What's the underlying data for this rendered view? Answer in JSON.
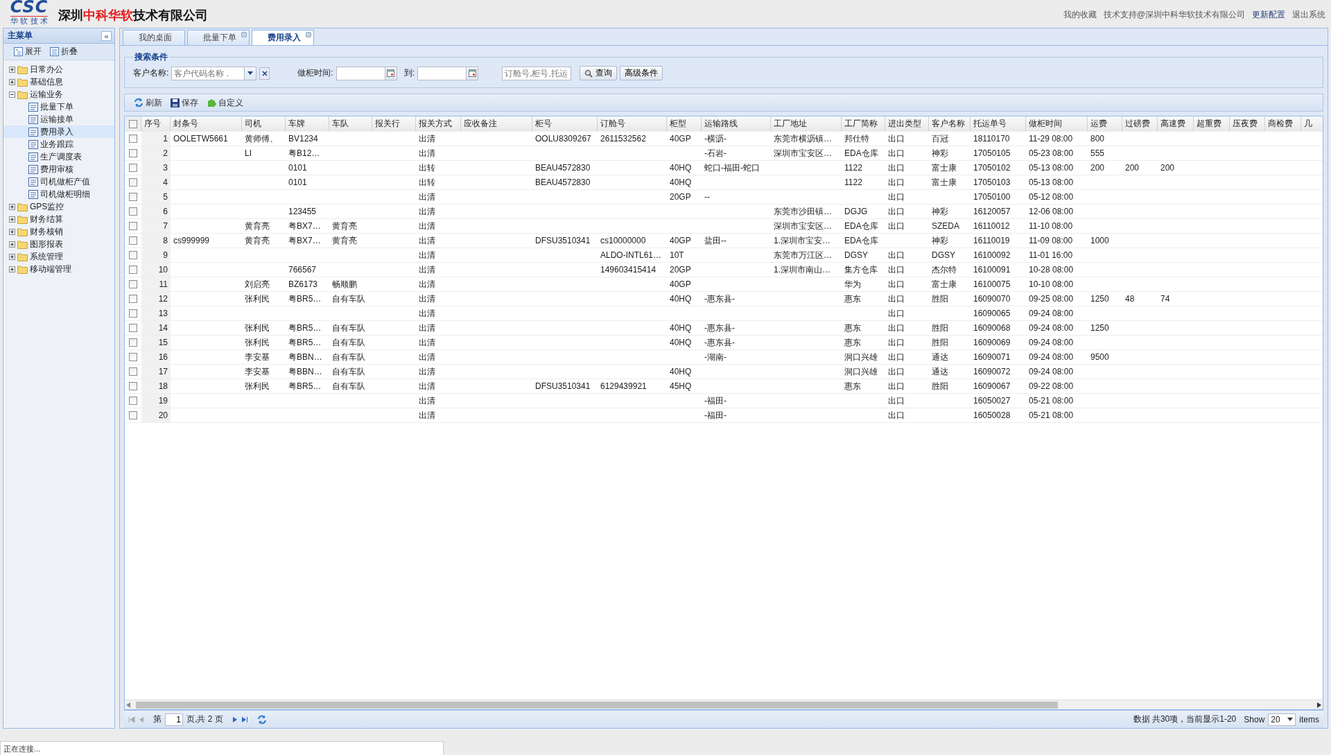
{
  "header": {
    "logo": {
      "mark": "CSC",
      "tagline": "华 软 技 术"
    },
    "company": "深圳**中科华软**技术有限公司",
    "links": [
      {
        "label": "我的收藏",
        "kind": "plain"
      },
      {
        "label": "技术支持@深圳中科华软技术有限公司",
        "kind": "plain"
      },
      {
        "label": "更新配置",
        "kind": "accent"
      },
      {
        "label": "退出系统",
        "kind": "plain"
      }
    ]
  },
  "sidebar": {
    "title": "主菜单",
    "collapse": "«",
    "actions": [
      {
        "label": "展开",
        "kind": "expand"
      },
      {
        "label": "折叠",
        "kind": "collapse"
      }
    ],
    "items": [
      {
        "label": "日常办公",
        "expanded": false,
        "selected": false
      },
      {
        "label": "基础信息",
        "expanded": false,
        "selected": false
      },
      {
        "label": "运输业务",
        "expanded": true,
        "selected": false,
        "children": [
          {
            "label": "批量下单",
            "selected": false
          },
          {
            "label": "运输接单",
            "selected": false
          },
          {
            "label": "费用录入",
            "selected": true
          },
          {
            "label": "业务跟踪",
            "selected": false
          },
          {
            "label": "生产调度表",
            "selected": false
          },
          {
            "label": "费用审核",
            "selected": false
          },
          {
            "label": "司机做柜产值",
            "selected": false
          },
          {
            "label": "司机做柜明细",
            "selected": false
          }
        ]
      },
      {
        "label": "GPS监控",
        "expanded": false,
        "selected": false
      },
      {
        "label": "财务结算",
        "expanded": false,
        "selected": false
      },
      {
        "label": "财务核销",
        "expanded": false,
        "selected": false
      },
      {
        "label": "图形报表",
        "expanded": false,
        "selected": false
      },
      {
        "label": "系统管理",
        "expanded": false,
        "selected": false
      },
      {
        "label": "移动端管理",
        "expanded": false,
        "selected": false
      }
    ]
  },
  "tabs": [
    {
      "label": "我的桌面",
      "selected": false,
      "closable": false
    },
    {
      "label": "批量下单",
      "selected": false,
      "closable": true
    },
    {
      "label": "费用录入",
      "selected": true,
      "closable": true
    }
  ],
  "search": {
    "legend": "搜索条件",
    "customer_label": "客户名称:",
    "customer_placeholder": "客户代码名称 .",
    "date_label": "做柜时间:",
    "to_label": "到:",
    "keyword_placeholder": "订舱号,柜号,托运",
    "query_button": "查询",
    "advanced_button": "高级条件"
  },
  "toolbar": [
    {
      "label": "刷新",
      "kind": "refresh"
    },
    {
      "label": "保存",
      "kind": "save"
    },
    {
      "label": "自定义",
      "kind": "custom"
    }
  ],
  "table": {
    "all_checked": false,
    "seq_label": "序号",
    "columns": [
      "封条号",
      "司机",
      "车牌",
      "车队",
      "报关行",
      "报关方式",
      "应收备注",
      "柜号",
      "订舱号",
      "柜型",
      "运输路线",
      "工厂地址",
      "工厂简称",
      "进出类型",
      "客户名称",
      "托运单号",
      "做柜时间",
      "运费",
      "过磅费",
      "高速费",
      "超重费",
      "压夜费",
      "商检费",
      "几"
    ],
    "rows": [
      {
        "seq": "1",
        "checked": false,
        "cells": [
          "OOLETW5661",
          "黄师傅、",
          "BV1234",
          null,
          null,
          "出清",
          null,
          "OOLU8309267",
          "2611532562",
          "40GP",
          "-横沥-",
          "东莞市横沥镇…",
          "邦仕特",
          "出口",
          "百冠",
          "18110170",
          "11-29 08:00",
          "800"
        ]
      },
      {
        "seq": "2",
        "checked": false,
        "cells": [
          null,
          "LI",
          "粤B12…",
          null,
          null,
          "出清",
          null,
          null,
          null,
          null,
          "-石岩-",
          "深圳市宝安区…",
          "EDA仓库",
          "出口",
          "神彩",
          "17050105",
          "05-23 08:00",
          "555"
        ]
      },
      {
        "seq": "3",
        "checked": false,
        "cells": [
          null,
          null,
          "0101",
          null,
          null,
          "出转",
          null,
          "BEAU4572830",
          null,
          "40HQ",
          "蛇口-福田-蛇口",
          null,
          "1122",
          "出口",
          "富士康",
          "17050102",
          "05-13 08:00",
          "200",
          "200",
          "200"
        ]
      },
      {
        "seq": "4",
        "checked": false,
        "cells": [
          null,
          null,
          "0101",
          null,
          null,
          "出转",
          null,
          "BEAU4572830",
          null,
          "40HQ",
          null,
          null,
          "1122",
          "出口",
          "富士康",
          "17050103",
          "05-13 08:00"
        ]
      },
      {
        "seq": "5",
        "checked": false,
        "cells": [
          null,
          null,
          null,
          null,
          null,
          "出清",
          null,
          null,
          null,
          "20GP",
          "--",
          null,
          null,
          "出口",
          null,
          "17050100",
          "05-12 08:00"
        ]
      },
      {
        "seq": "6",
        "checked": false,
        "cells": [
          null,
          null,
          "123455",
          null,
          null,
          "出清",
          null,
          null,
          null,
          null,
          null,
          "东莞市沙田镇…",
          "DGJG",
          "出口",
          "神彩",
          "16120057",
          "12-06 08:00"
        ]
      },
      {
        "seq": "7",
        "checked": false,
        "cells": [
          null,
          "黄育亮",
          "粤BX7…",
          "黄育亮",
          null,
          "出清",
          null,
          null,
          null,
          null,
          null,
          "深圳市宝安区…",
          "EDA仓库",
          "出口",
          "SZEDA",
          "16110012",
          "11-10 08:00"
        ]
      },
      {
        "seq": "8",
        "checked": false,
        "cells": [
          "cs999999",
          "黄育亮",
          "粤BX7…",
          "黄育亮",
          null,
          "出清",
          null,
          "DFSU3510341",
          "cs10000000",
          "40GP",
          "盐田--",
          "1.深圳市宝安…",
          "EDA仓库",
          null,
          "神彩",
          "16110019",
          "11-09 08:00",
          "1000"
        ]
      },
      {
        "seq": "9",
        "checked": false,
        "cells": [
          null,
          null,
          null,
          null,
          null,
          "出清",
          null,
          null,
          "ALDO-INTL61…",
          "10T",
          null,
          "东莞市万江区…",
          "DGSY",
          "出口",
          "DGSY",
          "16100092",
          "11-01 16:00"
        ]
      },
      {
        "seq": "10",
        "checked": false,
        "cells": [
          null,
          null,
          "766567",
          null,
          null,
          "出清",
          null,
          null,
          "149603415414",
          "20GP",
          null,
          "1.深圳市南山…",
          "集方仓库",
          "出口",
          "杰尔特",
          "16100091",
          "10-28 08:00"
        ]
      },
      {
        "seq": "11",
        "checked": false,
        "cells": [
          null,
          "刘启亮",
          "BZ6173",
          "畅顺鹏",
          null,
          "出清",
          null,
          null,
          null,
          "40GP",
          null,
          null,
          "华为",
          "出口",
          "富士康",
          "16100075",
          "10-10 08:00"
        ]
      },
      {
        "seq": "12",
        "checked": false,
        "cells": [
          null,
          "张利民",
          "粤BR5…",
          "自有车队",
          null,
          "出清",
          null,
          null,
          null,
          "40HQ",
          "-惠东县-",
          null,
          "惠东",
          "出口",
          "胜阳",
          "16090070",
          "09-25 08:00",
          "1250",
          "48",
          "74"
        ]
      },
      {
        "seq": "13",
        "checked": false,
        "cells": [
          null,
          null,
          null,
          null,
          null,
          "出清",
          null,
          null,
          null,
          null,
          null,
          null,
          null,
          "出口",
          null,
          "16090065",
          "09-24 08:00"
        ]
      },
      {
        "seq": "14",
        "checked": false,
        "cells": [
          null,
          "张利民",
          "粤BR5…",
          "自有车队",
          null,
          "出清",
          null,
          null,
          null,
          "40HQ",
          "-惠东县-",
          null,
          "惠东",
          "出口",
          "胜阳",
          "16090068",
          "09-24 08:00",
          "1250"
        ]
      },
      {
        "seq": "15",
        "checked": false,
        "cells": [
          null,
          "张利民",
          "粤BR5…",
          "自有车队",
          null,
          "出清",
          null,
          null,
          null,
          "40HQ",
          "-惠东县-",
          null,
          "惠东",
          "出口",
          "胜阳",
          "16090069",
          "09-24 08:00"
        ]
      },
      {
        "seq": "16",
        "checked": false,
        "cells": [
          null,
          "李安基",
          "粤BBN…",
          "自有车队",
          null,
          "出清",
          null,
          null,
          null,
          null,
          "-湖南-",
          null,
          "洞口兴雄",
          "出口",
          "通达",
          "16090071",
          "09-24 08:00",
          "9500"
        ]
      },
      {
        "seq": "17",
        "checked": false,
        "cells": [
          null,
          "李安基",
          "粤BBN…",
          "自有车队",
          null,
          "出清",
          null,
          null,
          null,
          "40HQ",
          null,
          null,
          "洞口兴雄",
          "出口",
          "通达",
          "16090072",
          "09-24 08:00"
        ]
      },
      {
        "seq": "18",
        "checked": false,
        "cells": [
          null,
          "张利民",
          "粤BR5…",
          "自有车队",
          null,
          "出清",
          null,
          "DFSU3510341",
          "6129439921",
          "45HQ",
          null,
          null,
          "惠东",
          "出口",
          "胜阳",
          "16090067",
          "09-22 08:00"
        ]
      },
      {
        "seq": "19",
        "checked": false,
        "cells": [
          null,
          null,
          null,
          null,
          null,
          "出清",
          null,
          null,
          null,
          null,
          "-福田-",
          null,
          null,
          "出口",
          null,
          "16050027",
          "05-21 08:00"
        ]
      },
      {
        "seq": "20",
        "checked": false,
        "cells": [
          null,
          null,
          null,
          null,
          null,
          "出清",
          null,
          null,
          null,
          null,
          "-福田-",
          null,
          null,
          "出口",
          null,
          "16050028",
          "05-21 08:00"
        ]
      }
    ]
  },
  "pager": {
    "page_label": "第",
    "page": "1",
    "total_label": "页,共 2 页",
    "summary": "数据 共30项，当前显示1-20",
    "show_label": "Show",
    "page_size": "20",
    "items_label": "items"
  },
  "status_bar": "正在连接..."
}
